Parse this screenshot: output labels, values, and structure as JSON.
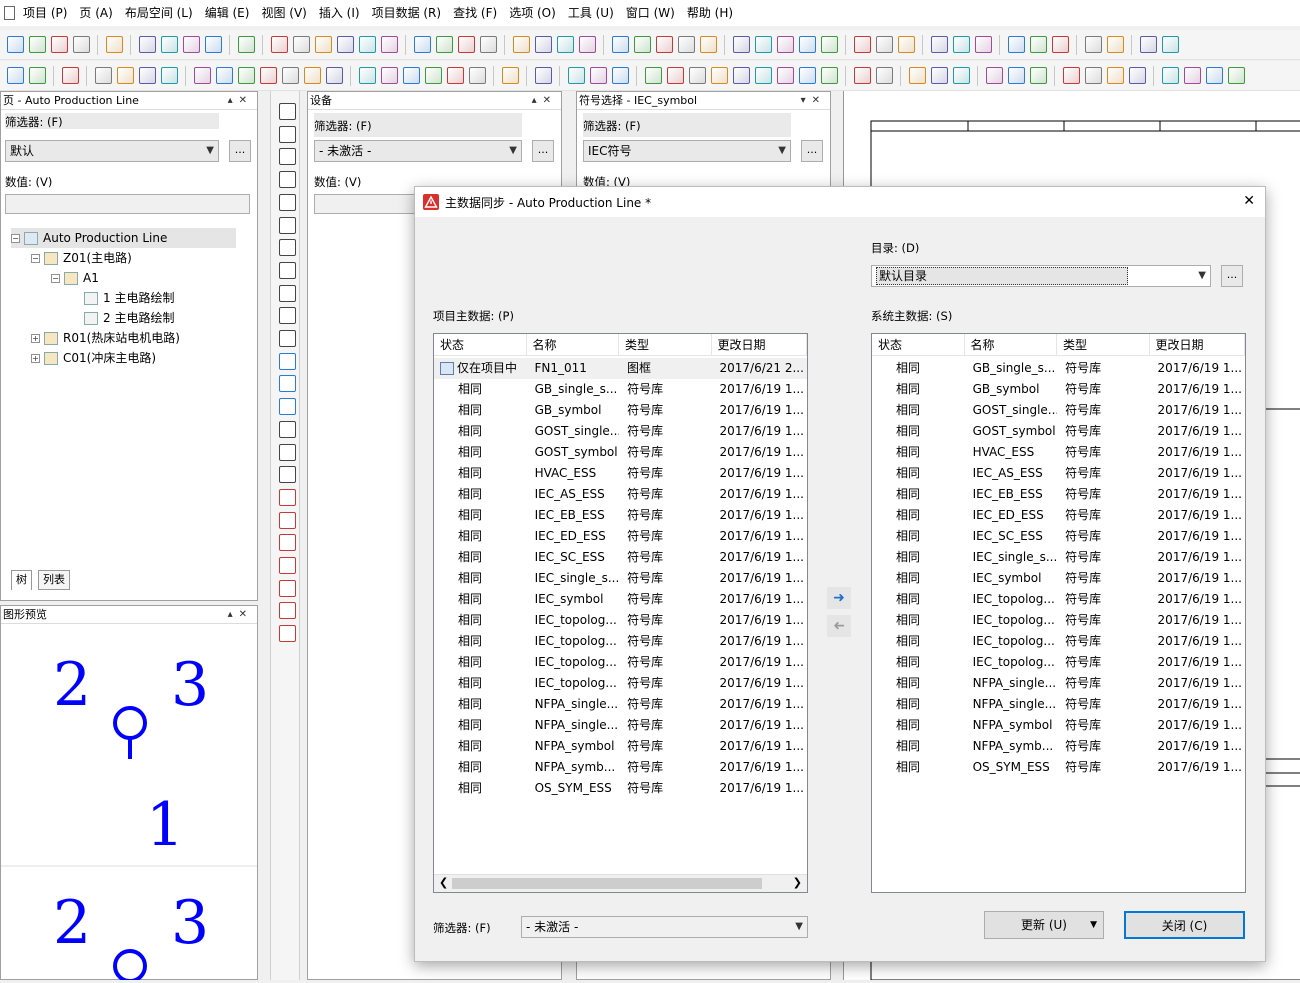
{
  "menu": {
    "items": [
      "项目 (P)",
      "页 (A)",
      "布局空间 (L)",
      "编辑 (E)",
      "视图 (V)",
      "插入 (I)",
      "项目数据 (R)",
      "查找 (F)",
      "选项 (O)",
      "工具 (U)",
      "窗口 (W)",
      "帮助 (H)"
    ]
  },
  "pages_panel": {
    "title": "页 - Auto Production Line",
    "filter_label": "筛选器: (F)",
    "filter_value": "默认",
    "value_label": "数值: (V)",
    "dots": "...",
    "tree": [
      {
        "label": "Auto Production Line",
        "level": 0,
        "expander": "−"
      },
      {
        "label": "Z01(主电路)",
        "level": 1,
        "expander": "−"
      },
      {
        "label": "A1",
        "level": 2,
        "expander": "−"
      },
      {
        "label": "1 主电路绘制",
        "level": 3,
        "expander": ""
      },
      {
        "label": "2 主电路绘制",
        "level": 3,
        "expander": ""
      },
      {
        "label": "R01(热床站电机电路)",
        "level": 1,
        "expander": "+"
      },
      {
        "label": "C01(冲床主电路)",
        "level": 1,
        "expander": "+"
      }
    ],
    "tabs": [
      "树",
      "列表"
    ]
  },
  "preview_panel": {
    "title": "图形预览",
    "numbers_top": [
      "2",
      "3",
      "1"
    ],
    "numbers_bottom": [
      "2",
      "3"
    ]
  },
  "device_panel": {
    "title": "设备",
    "filter_label": "筛选器: (F)",
    "filter_value": "- 未激活 -",
    "value_label": "数值: (V)",
    "dots": "..."
  },
  "symbol_panel": {
    "title": "符号选择 - IEC_symbol",
    "filter_label": "筛选器: (F)",
    "filter_value": "IEC符号",
    "value_label": "数值: (V)",
    "dots": "..."
  },
  "dialog": {
    "title": "主数据同步 - Auto Production Line *",
    "close_glyph": "✕",
    "catalog_label": "目录: (D)",
    "catalog_value": "默认目录",
    "dots": "...",
    "project_label": "项目主数据: (P)",
    "system_label": "系统主数据: (S)",
    "columns": [
      "状态",
      "名称",
      "类型",
      "更改日期"
    ],
    "project_rows": [
      [
        "仅在项目中",
        "FN1_011",
        "图框",
        "2017/6/21 2..."
      ],
      [
        "相同",
        "GB_single_s...",
        "符号库",
        "2017/6/19 1..."
      ],
      [
        "相同",
        "GB_symbol",
        "符号库",
        "2017/6/19 1..."
      ],
      [
        "相同",
        "GOST_single...",
        "符号库",
        "2017/6/19 1..."
      ],
      [
        "相同",
        "GOST_symbol",
        "符号库",
        "2017/6/19 1..."
      ],
      [
        "相同",
        "HVAC_ESS",
        "符号库",
        "2017/6/19 1..."
      ],
      [
        "相同",
        "IEC_AS_ESS",
        "符号库",
        "2017/6/19 1..."
      ],
      [
        "相同",
        "IEC_EB_ESS",
        "符号库",
        "2017/6/19 1..."
      ],
      [
        "相同",
        "IEC_ED_ESS",
        "符号库",
        "2017/6/19 1..."
      ],
      [
        "相同",
        "IEC_SC_ESS",
        "符号库",
        "2017/6/19 1..."
      ],
      [
        "相同",
        "IEC_single_s...",
        "符号库",
        "2017/6/19 1..."
      ],
      [
        "相同",
        "IEC_symbol",
        "符号库",
        "2017/6/19 1..."
      ],
      [
        "相同",
        "IEC_topolog...",
        "符号库",
        "2017/6/19 1..."
      ],
      [
        "相同",
        "IEC_topolog...",
        "符号库",
        "2017/6/19 1..."
      ],
      [
        "相同",
        "IEC_topolog...",
        "符号库",
        "2017/6/19 1..."
      ],
      [
        "相同",
        "IEC_topolog...",
        "符号库",
        "2017/6/19 1..."
      ],
      [
        "相同",
        "NFPA_single...",
        "符号库",
        "2017/6/19 1..."
      ],
      [
        "相同",
        "NFPA_single...",
        "符号库",
        "2017/6/19 1..."
      ],
      [
        "相同",
        "NFPA_symbol",
        "符号库",
        "2017/6/19 1..."
      ],
      [
        "相同",
        "NFPA_symb...",
        "符号库",
        "2017/6/19 1..."
      ],
      [
        "相同",
        "OS_SYM_ESS",
        "符号库",
        "2017/6/19 1..."
      ]
    ],
    "system_rows": [
      [
        "相同",
        "GB_single_s...",
        "符号库",
        "2017/6/19 1..."
      ],
      [
        "相同",
        "GB_symbol",
        "符号库",
        "2017/6/19 1..."
      ],
      [
        "相同",
        "GOST_single...",
        "符号库",
        "2017/6/19 1..."
      ],
      [
        "相同",
        "GOST_symbol",
        "符号库",
        "2017/6/19 1..."
      ],
      [
        "相同",
        "HVAC_ESS",
        "符号库",
        "2017/6/19 1..."
      ],
      [
        "相同",
        "IEC_AS_ESS",
        "符号库",
        "2017/6/19 1..."
      ],
      [
        "相同",
        "IEC_EB_ESS",
        "符号库",
        "2017/6/19 1..."
      ],
      [
        "相同",
        "IEC_ED_ESS",
        "符号库",
        "2017/6/19 1..."
      ],
      [
        "相同",
        "IEC_SC_ESS",
        "符号库",
        "2017/6/19 1..."
      ],
      [
        "相同",
        "IEC_single_s...",
        "符号库",
        "2017/6/19 1..."
      ],
      [
        "相同",
        "IEC_symbol",
        "符号库",
        "2017/6/19 1..."
      ],
      [
        "相同",
        "IEC_topolog...",
        "符号库",
        "2017/6/19 1..."
      ],
      [
        "相同",
        "IEC_topolog...",
        "符号库",
        "2017/6/19 1..."
      ],
      [
        "相同",
        "IEC_topolog...",
        "符号库",
        "2017/6/19 1..."
      ],
      [
        "相同",
        "IEC_topolog...",
        "符号库",
        "2017/6/19 1..."
      ],
      [
        "相同",
        "NFPA_single...",
        "符号库",
        "2017/6/19 1..."
      ],
      [
        "相同",
        "NFPA_single...",
        "符号库",
        "2017/6/19 1..."
      ],
      [
        "相同",
        "NFPA_symbol",
        "符号库",
        "2017/6/19 1..."
      ],
      [
        "相同",
        "NFPA_symb...",
        "符号库",
        "2017/6/19 1..."
      ],
      [
        "相同",
        "OS_SYM_ESS",
        "符号库",
        "2017/6/19 1..."
      ]
    ],
    "filter_label": "筛选器: (F)",
    "filter_value": "- 未激活 -",
    "update_button": "更新 (U)",
    "close_button": "关闭 (C)"
  },
  "colors": {
    "accent": "#0078d7",
    "preview_blue": "#0000ff",
    "dialog_icon": "#d9302b"
  }
}
